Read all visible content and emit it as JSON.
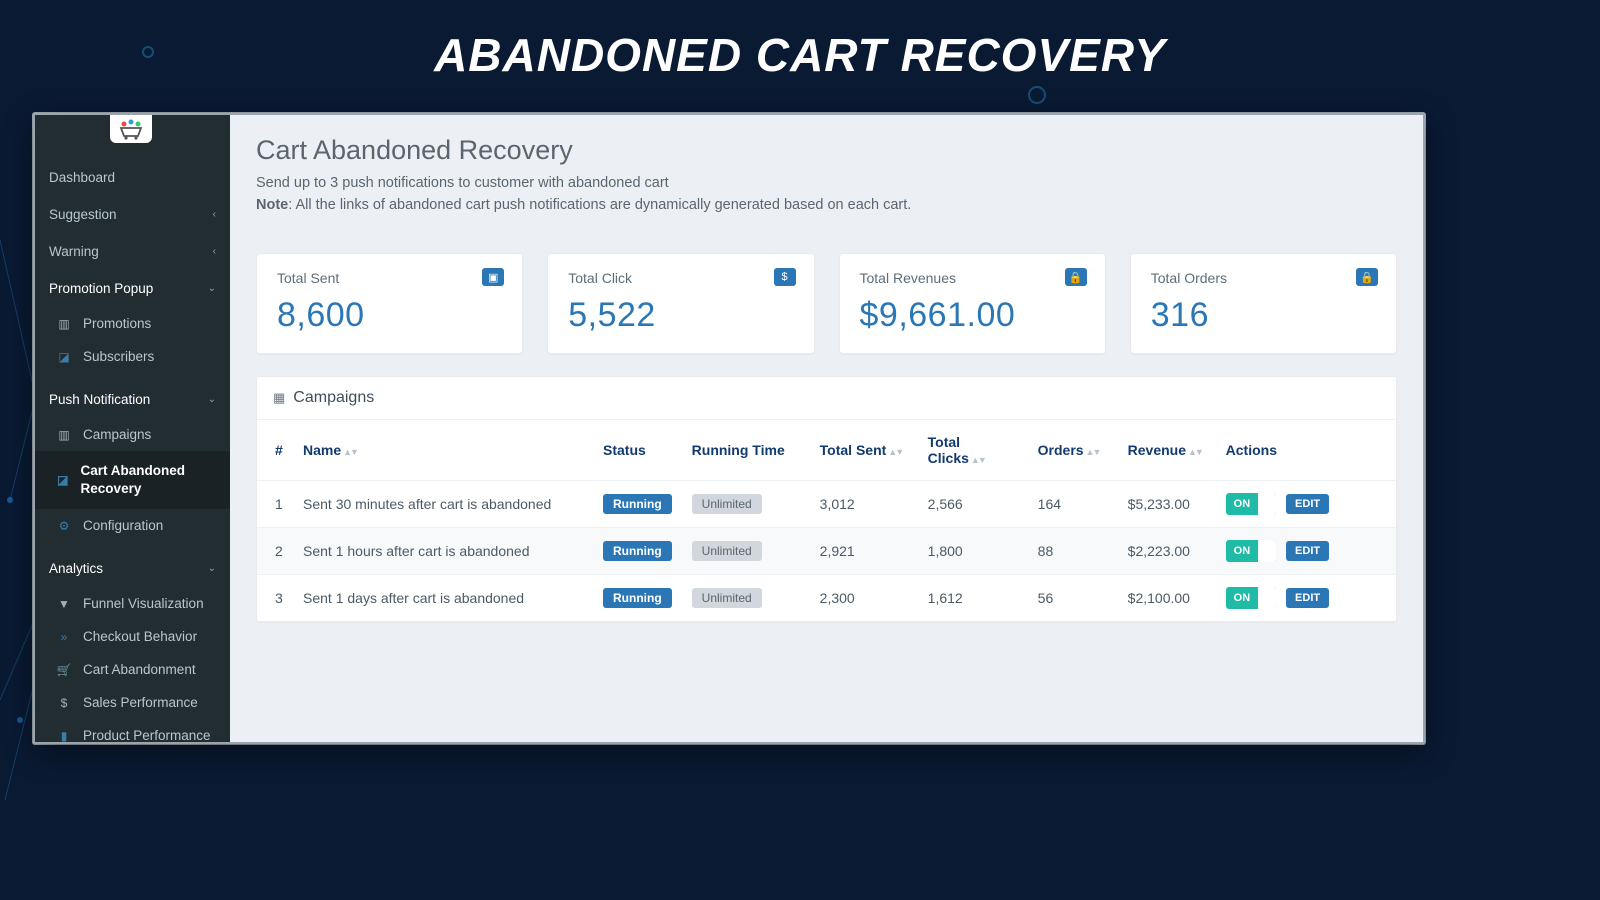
{
  "banner": "ABANDONED CART RECOVERY",
  "sidebar": {
    "dashboard": "Dashboard",
    "suggestion": "Suggestion",
    "warning": "Warning",
    "promo_header": "Promotion Popup",
    "promo_items": [
      "Promotions",
      "Subscribers"
    ],
    "push_header": "Push Notification",
    "push_items": [
      "Campaigns",
      "Cart Abandoned Recovery",
      "Configuration"
    ],
    "analytics_header": "Analytics",
    "analytics_items": [
      "Funnel Visualization",
      "Checkout Behavior",
      "Cart Abandonment",
      "Sales Performance",
      "Product Performance"
    ]
  },
  "page": {
    "title": "Cart Abandoned Recovery",
    "subtitle": "Send up to 3 push notifications to customer with abandoned cart",
    "note_bold": "Note",
    "note_rest": ": All the links of abandoned cart push notifications are dynamically generated based on each cart."
  },
  "stats": [
    {
      "label": "Total Sent",
      "value": "8,600",
      "icon": "▣"
    },
    {
      "label": "Total Click",
      "value": "5,522",
      "icon": "$"
    },
    {
      "label": "Total Revenues",
      "value": "$9,661.00",
      "icon": "🔒"
    },
    {
      "label": "Total Orders",
      "value": "316",
      "icon": "🔒"
    }
  ],
  "panel_title": "Campaigns",
  "columns": {
    "num": "#",
    "name": "Name",
    "status": "Status",
    "run": "Running Time",
    "sent": "Total Sent",
    "clicks": "Total Clicks",
    "orders": "Orders",
    "rev": "Revenue",
    "actions": "Actions"
  },
  "rows": [
    {
      "num": "1",
      "name": "Sent 30 minutes after cart is abandoned",
      "status": "Running",
      "run": "Unlimited",
      "sent": "3,012",
      "clicks": "2,566",
      "orders": "164",
      "rev": "$5,233.00"
    },
    {
      "num": "2",
      "name": "Sent 1 hours after cart is abandoned",
      "status": "Running",
      "run": "Unlimited",
      "sent": "2,921",
      "clicks": "1,800",
      "orders": "88",
      "rev": "$2,223.00"
    },
    {
      "num": "3",
      "name": "Sent 1 days after cart is abandoned",
      "status": "Running",
      "run": "Unlimited",
      "sent": "2,300",
      "clicks": "1,612",
      "orders": "56",
      "rev": "$2,100.00"
    }
  ],
  "toggle_on": "ON",
  "edit": "EDIT"
}
